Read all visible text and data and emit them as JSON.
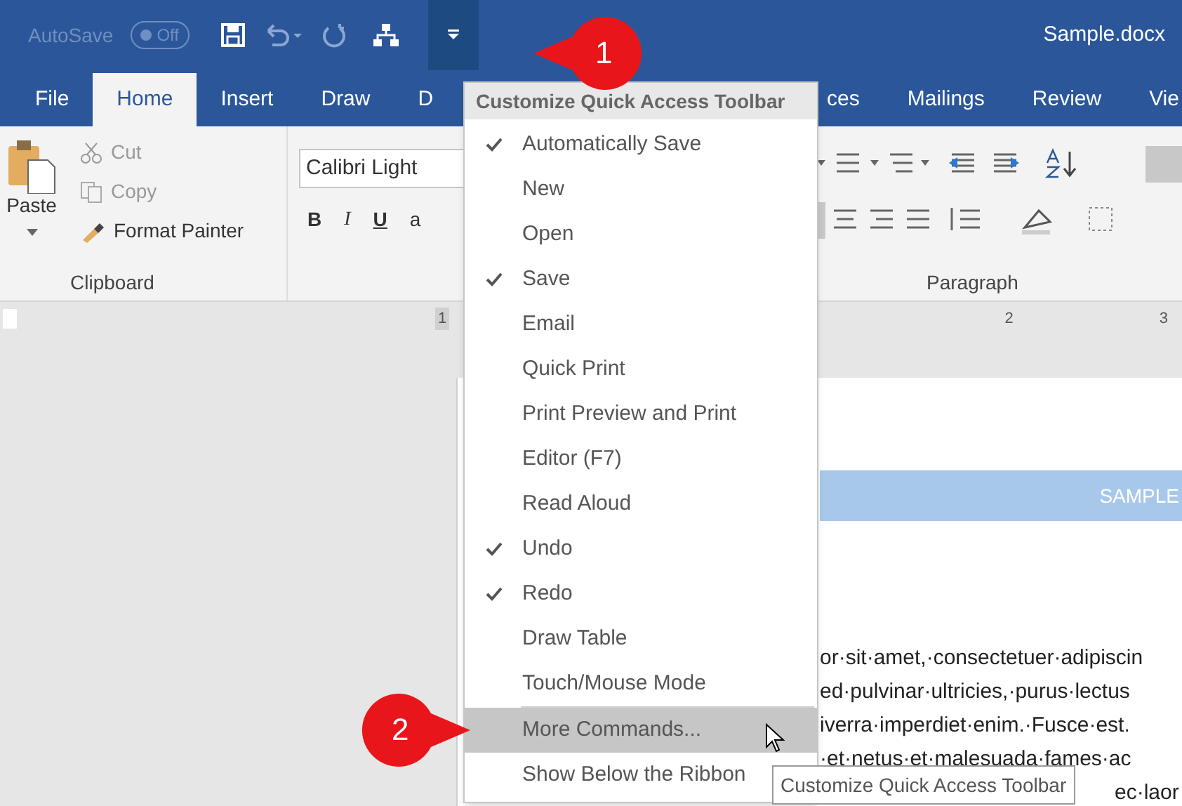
{
  "title_bar": {
    "autosave_label": "AutoSave",
    "autosave_toggle": {
      "label": "Off",
      "on": false
    },
    "document_title": "Sample.docx"
  },
  "tabs": [
    {
      "label": "File",
      "selected": false
    },
    {
      "label": "Home",
      "selected": true
    },
    {
      "label": "Insert",
      "selected": false
    },
    {
      "label": "Draw",
      "selected": false
    },
    {
      "label": "D",
      "selected": false
    }
  ],
  "tabs_right": [
    {
      "label": "ces",
      "selected": false
    },
    {
      "label": "Mailings",
      "selected": false
    },
    {
      "label": "Review",
      "selected": false
    },
    {
      "label": "Vie",
      "selected": false
    }
  ],
  "clipboard": {
    "paste": "Paste",
    "cut": "Cut",
    "copy": "Copy",
    "format_painter": "Format Painter",
    "group_label": "Clipboard"
  },
  "font": {
    "font_name": "Calibri Light",
    "bold": "B",
    "italic": "I",
    "underline": "U",
    "partial": "a"
  },
  "paragraph": {
    "group_label": "Paragraph"
  },
  "ruler": {
    "left_marks": [
      "1"
    ],
    "right_marks": [
      "2",
      "3"
    ]
  },
  "document": {
    "banner": "SAMPLE",
    "lines": [
      "or·sit·amet,·consectetuer·adipiscin",
      "ed·pulvinar·ultricies,·purus·lectus",
      "iverra·imperdiet·enim.·Fusce·est.",
      "·et·netus·et·malesuada·fames·ac",
      "ec·laor"
    ]
  },
  "menu": {
    "title": "Customize Quick Access Toolbar",
    "items": [
      {
        "label": "Automatically Save",
        "checked": true,
        "selected": false
      },
      {
        "label": "New",
        "checked": false,
        "selected": false
      },
      {
        "label": "Open",
        "checked": false,
        "selected": false
      },
      {
        "label": "Save",
        "checked": true,
        "selected": false
      },
      {
        "label": "Email",
        "checked": false,
        "selected": false
      },
      {
        "label": "Quick Print",
        "checked": false,
        "selected": false
      },
      {
        "label": "Print Preview and Print",
        "checked": false,
        "selected": false
      },
      {
        "label": "Editor (F7)",
        "checked": false,
        "selected": false
      },
      {
        "label": "Read Aloud",
        "checked": false,
        "selected": false
      },
      {
        "label": "Undo",
        "checked": true,
        "selected": false
      },
      {
        "label": "Redo",
        "checked": true,
        "selected": false
      },
      {
        "label": "Draw Table",
        "checked": false,
        "selected": false
      },
      {
        "label": "Touch/Mouse Mode",
        "checked": false,
        "selected": false
      },
      {
        "label": "More Commands...",
        "checked": false,
        "selected": true
      },
      {
        "label": "Show Below the Ribbon",
        "checked": false,
        "selected": false
      }
    ]
  },
  "tooltip": "Customize Quick Access Toolbar",
  "callouts": [
    "1",
    "2"
  ]
}
